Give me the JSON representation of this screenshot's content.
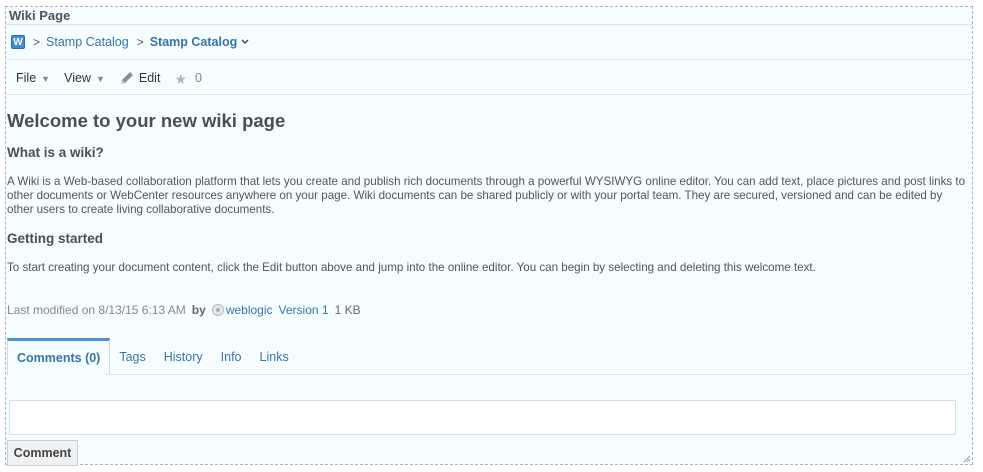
{
  "window": {
    "title": "Wiki Page"
  },
  "breadcrumb": {
    "app_icon": "wiki-icon",
    "app_icon_letter": "W",
    "separator": ">",
    "items": [
      "Stamp Catalog",
      "Stamp Catalog"
    ]
  },
  "toolbar": {
    "file_label": "File",
    "view_label": "View",
    "edit_label": "Edit",
    "rating_count": "0"
  },
  "article": {
    "title": "Welcome to your new wiki page",
    "section1_heading": "What is a wiki?",
    "section1_body": "A Wiki is a Web-based collaboration platform that lets you create and publish rich documents through a powerful WYSIWYG online editor. You can add text, place pictures and post links to other documents or WebCenter resources anywhere on your page. Wiki documents can be shared publicly or with your portal team. They are secured, versioned and can be edited by other users to create living collaborative documents.",
    "section2_heading": "Getting started",
    "section2_body": "To start creating your document content, click the Edit button above and jump into the online editor. You can begin by selecting and deleting this welcome text."
  },
  "meta": {
    "modified": "Last modified on 8/13/15 6:13 AM",
    "by_label": "by",
    "user": "weblogic",
    "version": "Version 1",
    "size": "1 KB"
  },
  "tabs": [
    "Comments (0)",
    "Tags",
    "History",
    "Info",
    "Links"
  ],
  "comment": {
    "placeholder": "",
    "button_label": "Comment"
  },
  "colors": {
    "link": "#3974a8",
    "active_tab": "#4a90d0",
    "panel_background": "#f5fdff"
  }
}
